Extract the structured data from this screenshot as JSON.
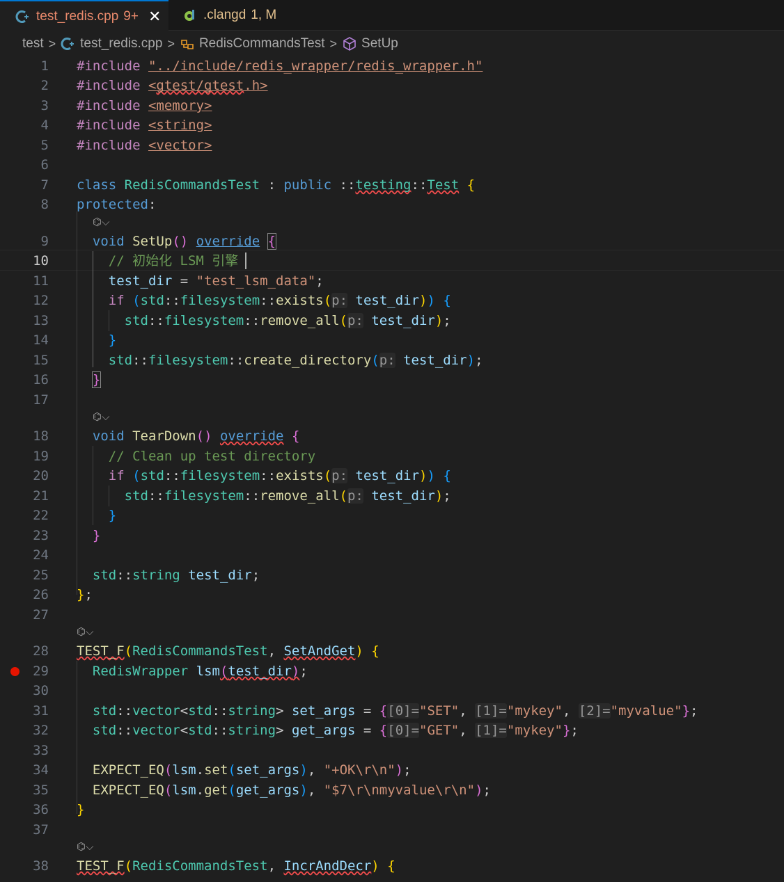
{
  "tabs": [
    {
      "label": "test_redis.cpp",
      "count": "9+",
      "close": "✕"
    },
    {
      "label": ".clangd",
      "count": "1, M"
    }
  ],
  "breadcrumb": {
    "folder": "test",
    "file": "test_redis.cpp",
    "class": "RedisCommandsTest",
    "method": "SetUp"
  },
  "editor": {
    "current_line": 10,
    "breakpoint_line": 29,
    "codelens_glyph": "⌬⌵",
    "lines": [
      "#include \"../include/redis_wrapper/redis_wrapper.h\"",
      "#include <gtest/gtest.h>",
      "#include <memory>",
      "#include <string>",
      "#include <vector>",
      "",
      "class RedisCommandsTest : public ::testing::Test {",
      "protected:",
      "  void SetUp() override {",
      "    // 初始化 LSM 引擎",
      "    test_dir = \"test_lsm_data\";",
      "    if (std::filesystem::exists(p: test_dir)) {",
      "      std::filesystem::remove_all(p: test_dir);",
      "    }",
      "    std::filesystem::create_directory(p: test_dir);",
      "  }",
      "",
      "  void TearDown() override {",
      "    // Clean up test directory",
      "    if (std::filesystem::exists(p: test_dir)) {",
      "      std::filesystem::remove_all(p: test_dir);",
      "    }",
      "  }",
      "",
      "  std::string test_dir;",
      "};",
      "",
      "TEST_F(RedisCommandsTest, SetAndGet) {",
      "  RedisWrapper lsm(test_dir);",
      "",
      "  std::vector<std::string> set_args = {[0]=\"SET\", [1]=\"mykey\", [2]=\"myvalue\"};",
      "  std::vector<std::string> get_args = {[0]=\"GET\", [1]=\"mykey\"};",
      "",
      "  EXPECT_EQ(lsm.set(set_args), \"+OK\\r\\n\");",
      "  EXPECT_EQ(lsm.get(get_args), \"$7\\r\\nmyvalue\\r\\n\");",
      "}",
      "",
      "TEST_F(RedisCommandsTest, IncrAndDecr) {"
    ]
  }
}
